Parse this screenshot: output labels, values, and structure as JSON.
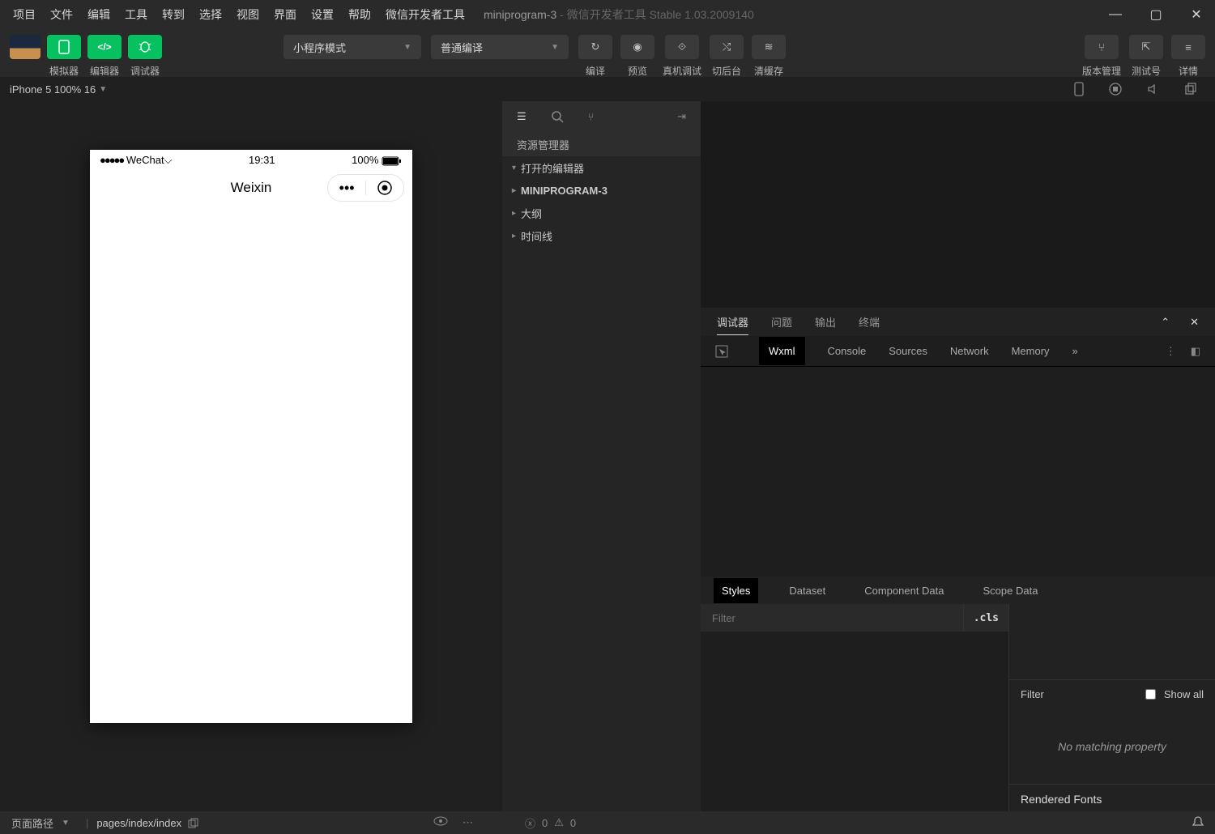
{
  "titlebar": {
    "menus": [
      "项目",
      "文件",
      "编辑",
      "工具",
      "转到",
      "选择",
      "视图",
      "界面",
      "设置",
      "帮助",
      "微信开发者工具"
    ],
    "project": "miniprogram-3",
    "app_title": "微信开发者工具 Stable 1.03.2009140"
  },
  "toolbar": {
    "simulator": "模拟器",
    "editor": "编辑器",
    "debugger": "调试器",
    "mode": "小程序模式",
    "compile": "普通编译",
    "actions": {
      "compile_btn": "编译",
      "preview": "预览",
      "remote": "真机调试",
      "background": "切后台",
      "clear": "清缓存"
    },
    "right": {
      "version": "版本管理",
      "test": "测试号",
      "detail": "详情"
    }
  },
  "infobar": {
    "device": "iPhone 5 100% 16"
  },
  "phone": {
    "carrier": "WeChat",
    "time": "19:31",
    "battery": "100%",
    "nav_title": "Weixin"
  },
  "explorer": {
    "title": "资源管理器",
    "rows": [
      {
        "label": "打开的编辑器",
        "open": true
      },
      {
        "label": "MINIPROGRAM-3",
        "bold": true
      },
      {
        "label": "大纲"
      },
      {
        "label": "时间线"
      }
    ]
  },
  "panel": {
    "tabs": [
      "调试器",
      "问题",
      "输出",
      "终端"
    ],
    "devtabs": [
      "Wxml",
      "Console",
      "Sources",
      "Network",
      "Memory"
    ],
    "subtabs": [
      "Styles",
      "Dataset",
      "Component Data",
      "Scope Data"
    ],
    "filter_ph": "Filter",
    "cls": ".cls",
    "filter2": "Filter",
    "showall": "Show all",
    "nomatch": "No matching property",
    "rendered": "Rendered Fonts"
  },
  "footer": {
    "page_path_lbl": "页面路径",
    "page_path": "pages/index/index",
    "err": "0",
    "warn": "0"
  }
}
